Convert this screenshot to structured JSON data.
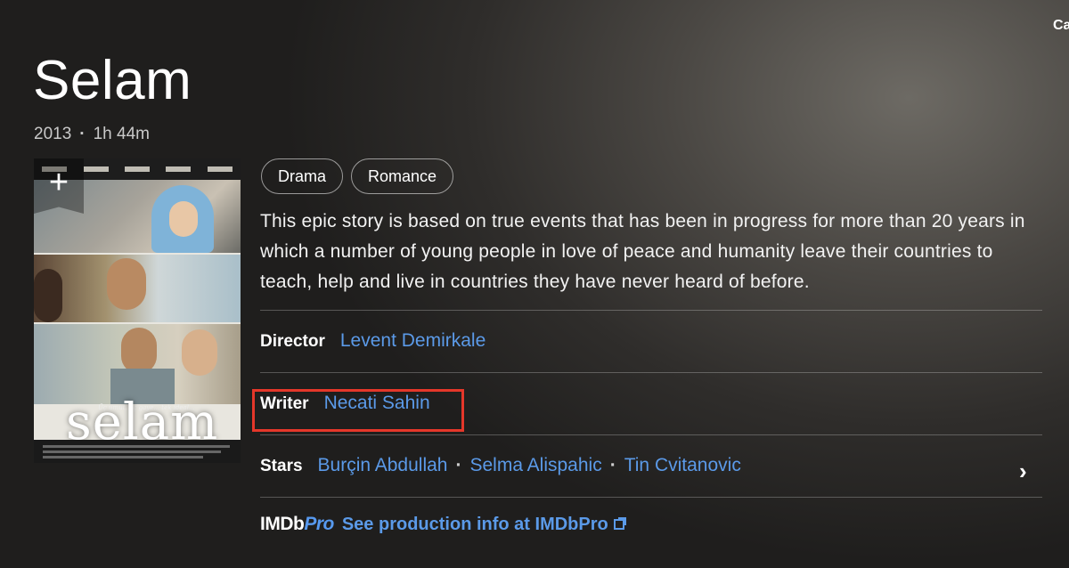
{
  "corner_text": "Ca",
  "movie": {
    "title": "Selam",
    "year": "2013",
    "runtime": "1h 44m"
  },
  "poster": {
    "word": "selam",
    "tagline": "Üç umut, üç gaye... tek ideal..."
  },
  "add_button": {
    "icon": "plus-icon",
    "glyph": "+"
  },
  "genres": [
    "Drama",
    "Romance"
  ],
  "plot": "This epic story is based on true events that has been in progress for more than 20 years in which a number of young people in love of peace and humanity leave their countries to teach, help and live in countries they have never heard of before.",
  "credits": {
    "director": {
      "label": "Director",
      "names": [
        "Levent Demirkale"
      ]
    },
    "writer": {
      "label": "Writer",
      "names": [
        "Necati Sahin"
      ]
    },
    "stars": {
      "label": "Stars",
      "names": [
        "Burçin Abdullah",
        "Selma Alispahic",
        "Tin Cvitanovic"
      ]
    }
  },
  "imdbpro": {
    "logo_imdb": "IMDb",
    "logo_pro": "Pro",
    "link": "See production info at IMDbPro"
  },
  "colors": {
    "link": "#5b9ae8",
    "highlight_box": "#e5372a",
    "pro_accent": "#5799ef"
  }
}
